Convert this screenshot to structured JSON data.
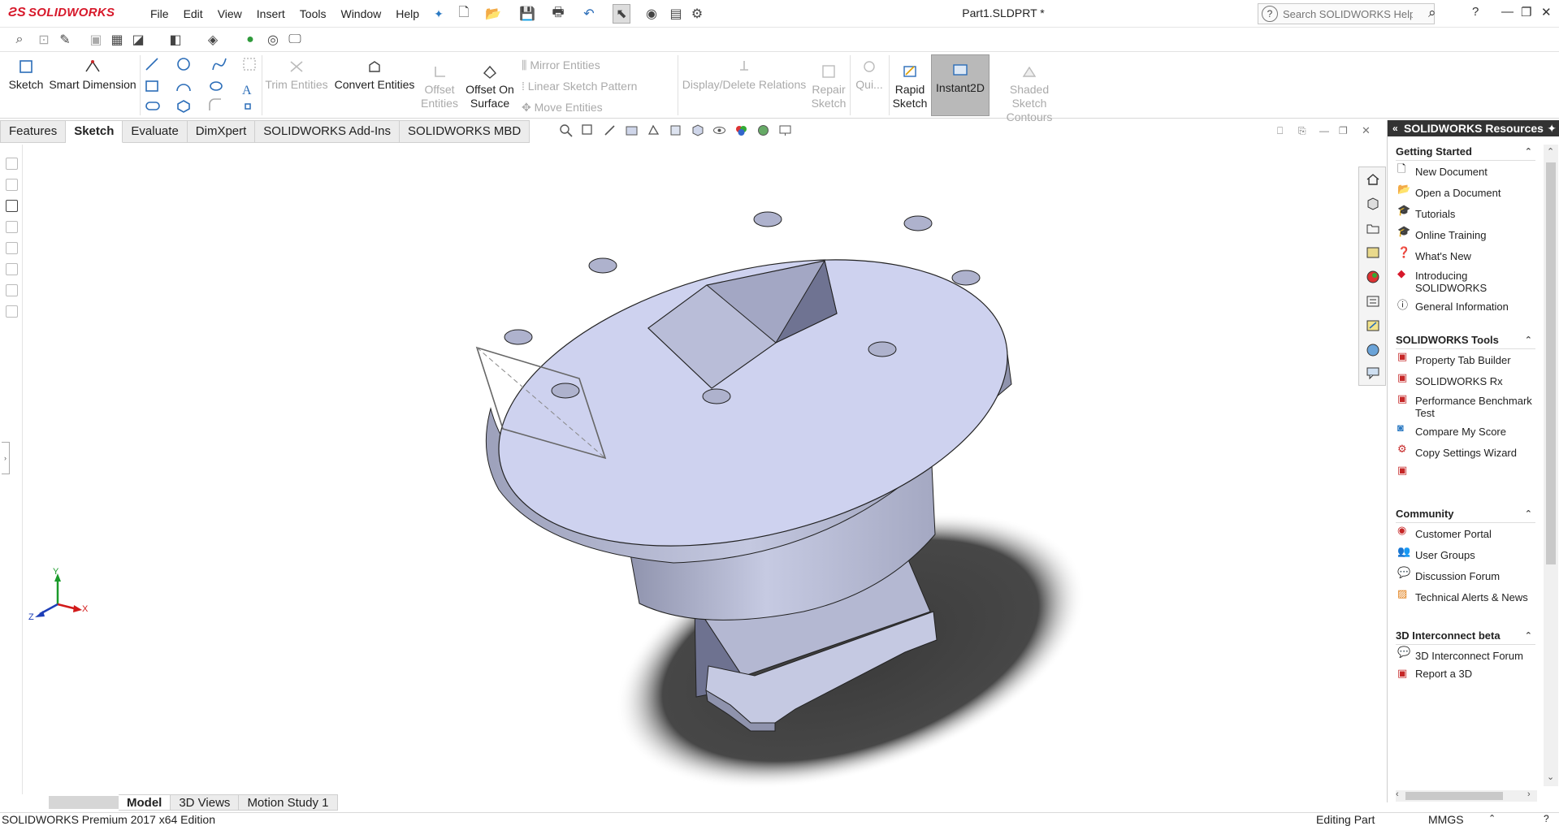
{
  "app": {
    "brand": "SOLIDWORKS",
    "document_title": "Part1.SLDPRT *"
  },
  "menu": [
    "File",
    "Edit",
    "View",
    "Insert",
    "Tools",
    "Window",
    "Help"
  ],
  "search": {
    "placeholder": "Search SOLIDWORKS Help"
  },
  "ribbon": {
    "sketch": "Sketch",
    "smart_dimension": "Smart Dimension",
    "trim_entities": "Trim Entities",
    "convert_entities": "Convert Entities",
    "offset_entities_1": "Offset",
    "offset_entities_2": "Entities",
    "offset_on_surface_1": "Offset On",
    "offset_on_surface_2": "Surface",
    "mirror_entities": "Mirror Entities",
    "linear_sketch_pattern": "Linear Sketch Pattern",
    "move_entities": "Move Entities",
    "display_delete_relations": "Display/Delete Relations",
    "repair_sketch_1": "Repair",
    "repair_sketch_2": "Sketch",
    "quick_snaps": "Qui...",
    "rapid_sketch_1": "Rapid",
    "rapid_sketch_2": "Sketch",
    "instant2d": "Instant2D",
    "shaded_contours_1": "Shaded Sketch",
    "shaded_contours_2": "Contours"
  },
  "command_tabs": [
    "Features",
    "Sketch",
    "Evaluate",
    "DimXpert",
    "SOLIDWORKS Add-Ins",
    "SOLIDWORKS MBD"
  ],
  "active_command_tab": "Sketch",
  "panel": {
    "title": "SOLIDWORKS Resources",
    "getting_started": {
      "title": "Getting Started",
      "items": [
        "New Document",
        "Open a Document",
        "Tutorials",
        "Online Training",
        "What's New",
        "Introducing SOLIDWORKS",
        "General Information"
      ]
    },
    "tools": {
      "title": "SOLIDWORKS Tools",
      "items": [
        "Property Tab Builder",
        "SOLIDWORKS Rx",
        "Performance Benchmark Test",
        "Compare My Score",
        "Copy Settings Wizard"
      ]
    },
    "community": {
      "title": "Community",
      "items": [
        "Customer Portal",
        "User Groups",
        "Discussion Forum",
        "Technical Alerts & News"
      ]
    },
    "interconnect": {
      "title": "3D Interconnect beta",
      "items": [
        "3D Interconnect Forum",
        "Report a 3D"
      ]
    }
  },
  "triad": {
    "x": "X",
    "y": "Y",
    "z": "Z"
  },
  "bottom_tabs": [
    "Model",
    "3D Views",
    "Motion Study 1"
  ],
  "status": {
    "edition": "SOLIDWORKS Premium 2017 x64 Edition",
    "mode": "Editing Part",
    "units": "MMGS"
  },
  "colors": {
    "brand_red": "#d7182a",
    "model_face": "#c9cde8",
    "shadow": "#3a3a3a",
    "panel_header": "#333333"
  }
}
